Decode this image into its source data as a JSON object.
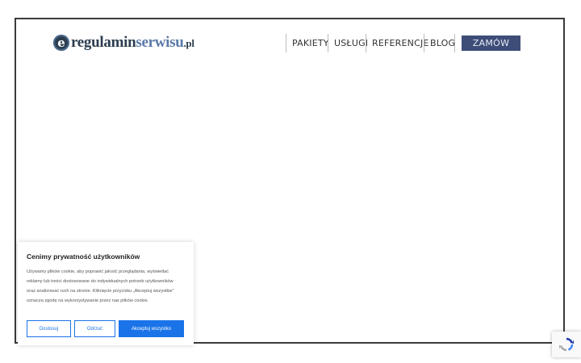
{
  "logo": {
    "mark": "e",
    "part1": "regulamin",
    "part2": "serwisu",
    "tld": ".pl"
  },
  "nav": {
    "items": [
      "PAKIETY",
      "USŁUGI",
      "REFERENCJE",
      "BLOG"
    ],
    "order_label": "ZAMÓW"
  },
  "cookie": {
    "title": "Cenimy prywatność użytkowników",
    "text": "Używamy plików cookie, aby poprawić jakość przeglądania, wyświetlać reklamy lub treści dostosowane do indywidualnych potrzeb użytkowników oraz analizować ruch na stronie. Kliknięcie przycisku „Akceptuj wszystkie” oznacza zgodę na wykorzystywanie przez nas plików cookie.",
    "customize_label": "Dostosuj",
    "reject_label": "Odrzuć",
    "accept_label": "Akceptuj wszystko"
  },
  "colors": {
    "brand_dark": "#2d3e50",
    "brand_light": "#5a79a8",
    "order_bg": "#3d4d78",
    "accent": "#1a73e8"
  },
  "icons": {
    "recaptcha": "recaptcha-icon"
  }
}
